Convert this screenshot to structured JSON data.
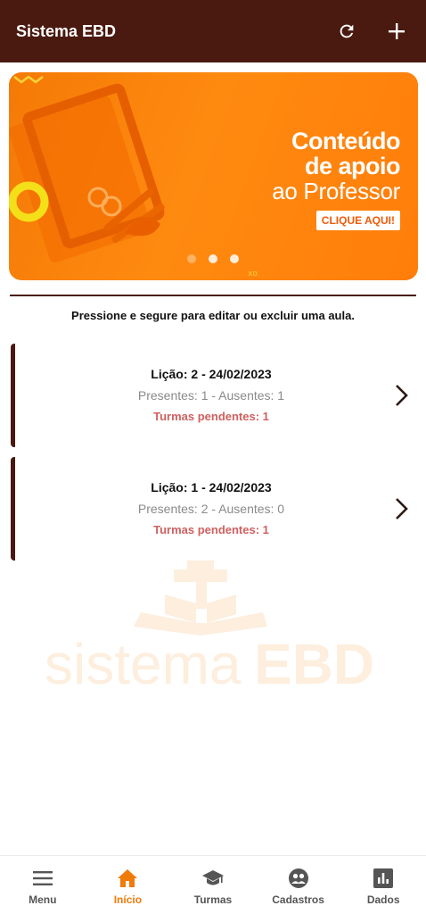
{
  "header": {
    "title": "Sistema EBD",
    "refresh_icon": "refresh-icon",
    "add_icon": "plus-icon",
    "bg_color": "#4a1a10"
  },
  "banner": {
    "line1": "Conteúdo",
    "line2": "de apoio",
    "line3": "ao Professor",
    "cta": "CLIQUE AQUI!",
    "slides": 3,
    "active_slide": 2
  },
  "hint": "Pressione e segure para editar ou excluir uma aula.",
  "lessons": [
    {
      "title": "Lição: 2 - 24/02/2023",
      "counts": "Presentes: 1 - Ausentes: 1",
      "pending": "Turmas pendentes: 1"
    },
    {
      "title": "Lição: 1 - 24/02/2023",
      "counts": "Presentes: 2 - Ausentes: 0",
      "pending": "Turmas pendentes: 1"
    }
  ],
  "watermark": {
    "text_light": "sistema",
    "text_bold": "EBD"
  },
  "nav": [
    {
      "label": "Menu",
      "icon": "menu-icon",
      "active": false
    },
    {
      "label": "Início",
      "icon": "home-icon",
      "active": true
    },
    {
      "label": "Turmas",
      "icon": "graduation-cap-icon",
      "active": false
    },
    {
      "label": "Cadastros",
      "icon": "people-icon",
      "active": false
    },
    {
      "label": "Dados",
      "icon": "bar-chart-icon",
      "active": false
    }
  ],
  "colors": {
    "accent": "#f07a0a",
    "brand_dark": "#4a1a10",
    "pending": "#d06060"
  }
}
